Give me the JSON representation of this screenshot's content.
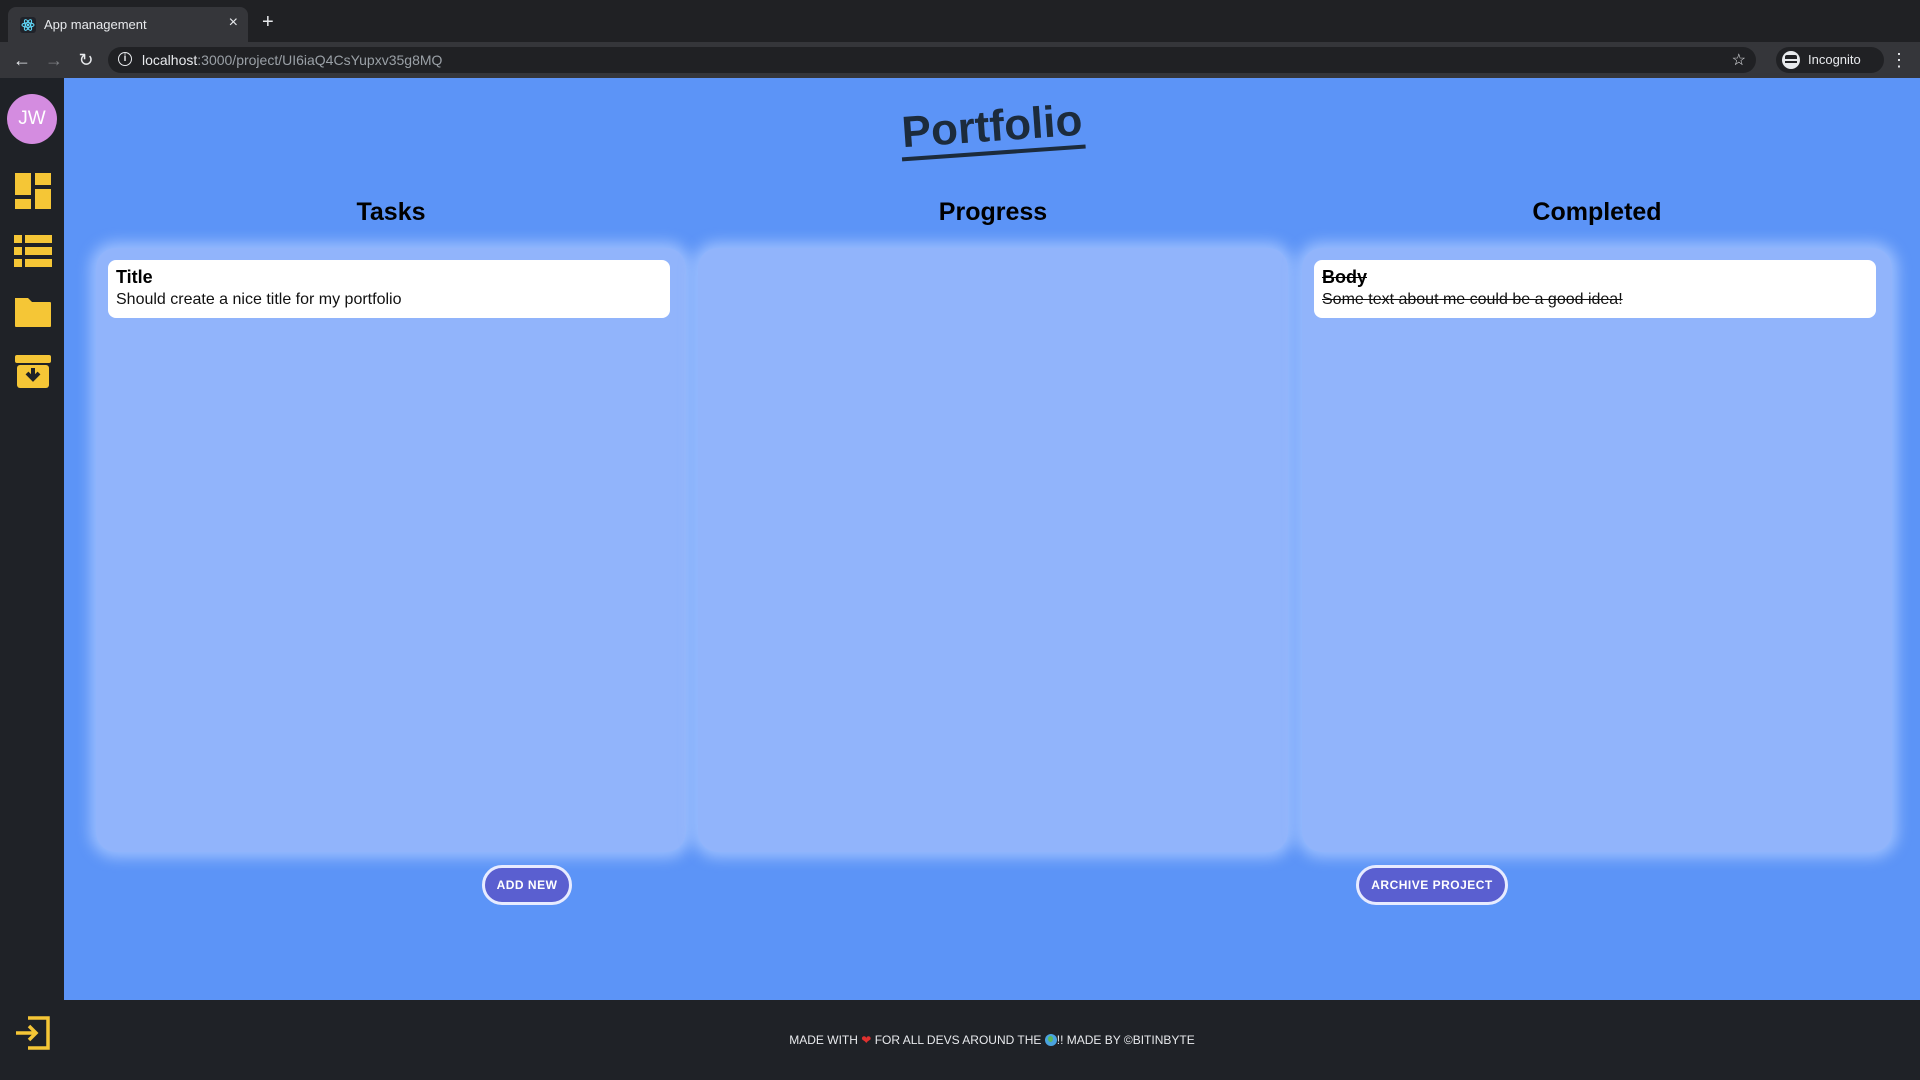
{
  "browser": {
    "tab_title": "App management",
    "tab_close": "×",
    "new_tab": "+",
    "url_host": "localhost",
    "url_path": ":3000/project/UI6iaQ4CsYupxv35g8MQ",
    "profile_label": "Incognito",
    "back": "←",
    "forward": "→",
    "reload": "↻",
    "star": "☆",
    "menu": "⋮"
  },
  "sidebar": {
    "avatar_initials": "JW",
    "icons": [
      "dashboard-icon",
      "list-icon",
      "folder-icon",
      "archive-box-icon",
      "logout-icon"
    ]
  },
  "page": {
    "title": "Portfolio"
  },
  "columns": [
    {
      "title": "Tasks",
      "cards": [
        {
          "title": "Title",
          "body": "Should create a nice title for my portfolio"
        }
      ]
    },
    {
      "title": "Progress",
      "cards": []
    },
    {
      "title": "Completed",
      "cards": [
        {
          "title": "Body",
          "body": "Some text about me could be a good idea!"
        }
      ]
    }
  ],
  "buttons": {
    "add_new": "ADD NEW",
    "archive_project": "ARCHIVE PROJECT"
  },
  "footer": {
    "part1": "MADE WITH",
    "heart": "❤",
    "part2": "FOR ALL DEVS AROUND THE",
    "part3": "!! MADE BY ©BITINBYTE"
  },
  "colors": {
    "main_bg": "#5c94f7",
    "column_bg": "#91b4fb",
    "button_bg": "#5a5fd0",
    "sidebar_icon": "#f5c636",
    "avatar_bg": "#d48ce0"
  }
}
